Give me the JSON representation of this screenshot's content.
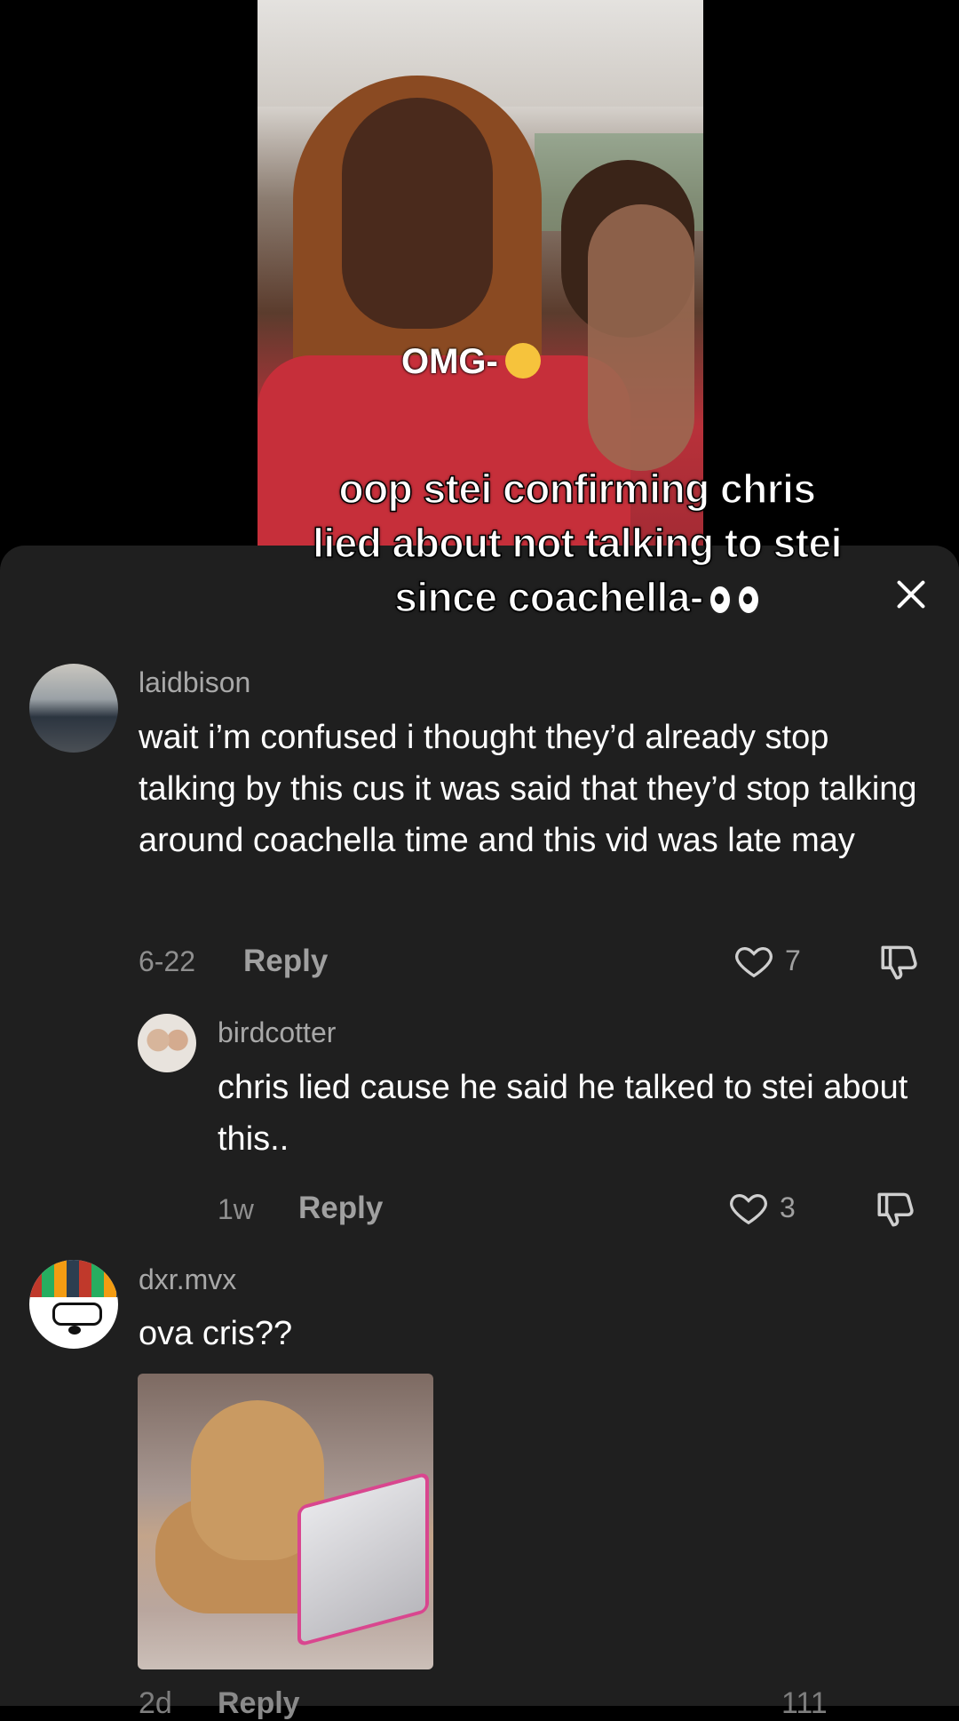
{
  "video": {
    "overlay_label": "OMG-",
    "caption": "oop stei confirming chris lied about not talking to stei since coachella-"
  },
  "comments": [
    {
      "username": "laidbison",
      "text": "wait i’m confused i thought they’d already stop talking by this cus it was said that they’d stop talking around coachella time and this vid was late may",
      "date": "6-22",
      "reply_label": "Reply",
      "likes": "7"
    },
    {
      "username": "birdcotter",
      "text": "chris lied cause he said he talked to stei about this..",
      "date": "1w",
      "reply_label": "Reply",
      "likes": "3"
    },
    {
      "username": "dxr.mvx",
      "text": "ova cris??",
      "date": "2d",
      "reply_label": "Reply",
      "likes": "111"
    }
  ],
  "colors": {
    "sheet_bg": "#1f1f1f",
    "text": "#ffffff",
    "muted": "#a8a8a8"
  }
}
